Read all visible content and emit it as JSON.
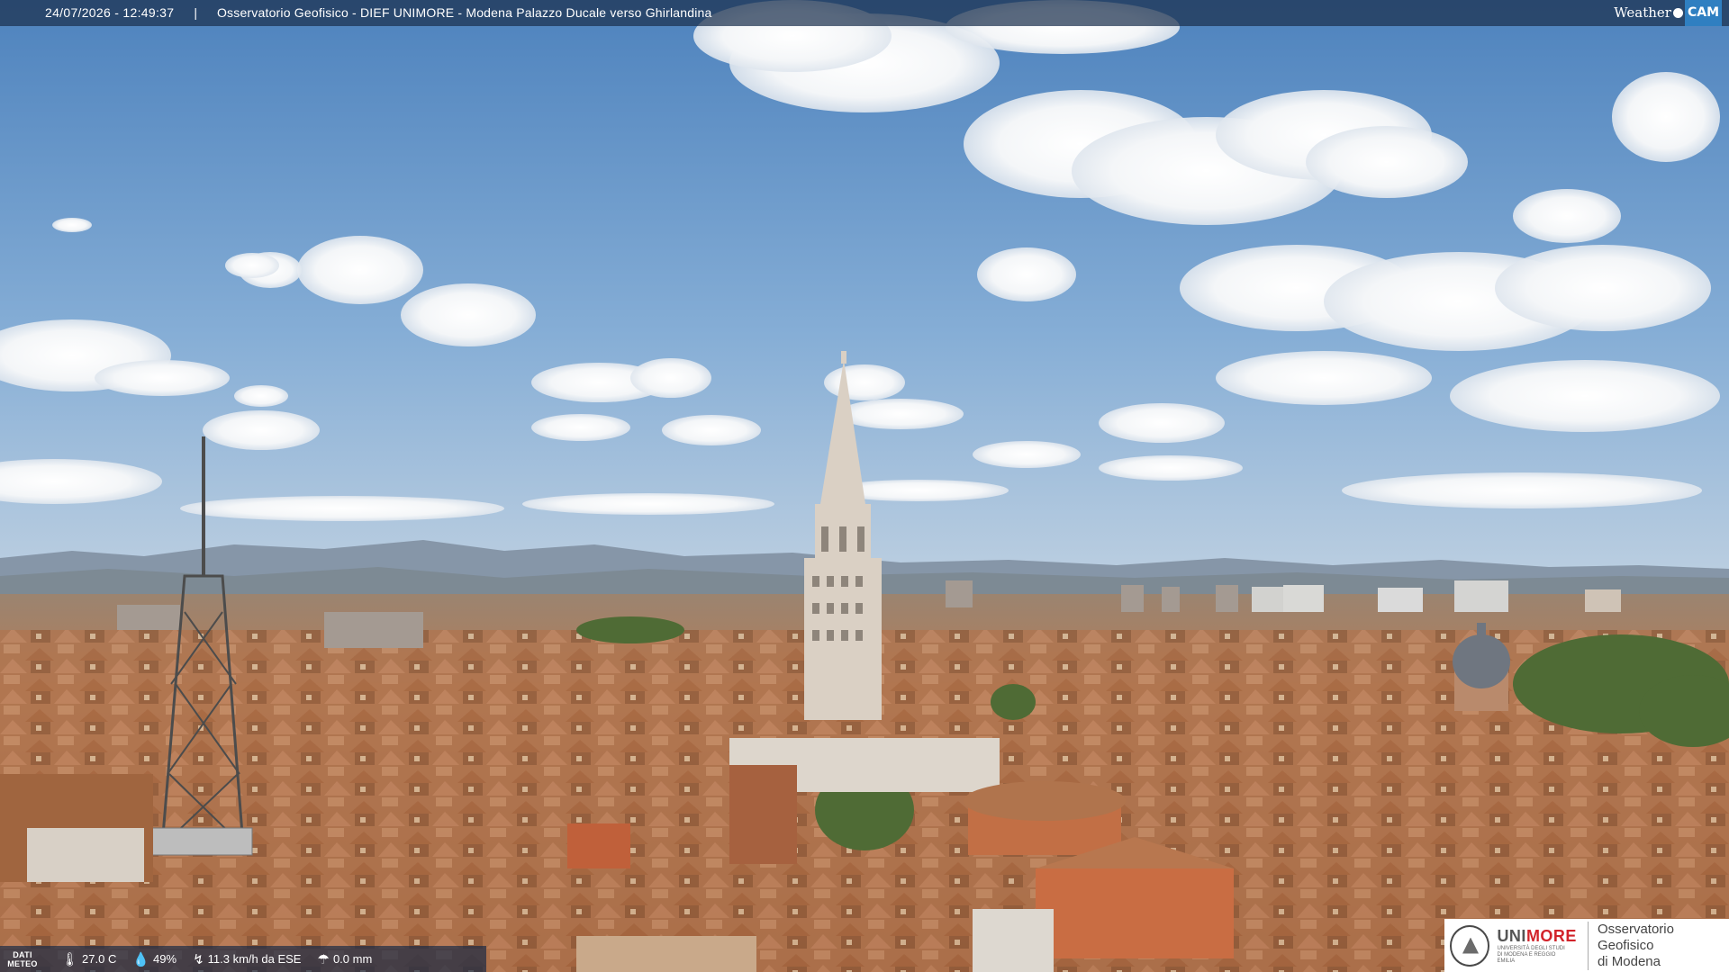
{
  "overlay": {
    "timestamp": "24/07/2026 - 12:49:37",
    "separator": "|",
    "title": "Osservatorio Geofisico - DIEF UNIMORE - Modena Palazzo Ducale verso Ghirlandina"
  },
  "brand": {
    "weather": "Weather",
    "cam": "CAM"
  },
  "weather_data": {
    "label": "DATI METEO",
    "temperature": "27.0 C",
    "humidity": "49%",
    "wind": "11.3 km/h da ESE",
    "rain": "0.0 mm",
    "icons": [
      "thermometer-icon",
      "humidity-icon",
      "wind-icon",
      "rain-icon"
    ]
  },
  "logo": {
    "unimore_prefix": "UNI",
    "unimore_suffix": "MORE",
    "university": "UNIVERSITÀ DEGLI STUDI DI MODENA E REGGIO EMILIA",
    "observatory_line1": "Osservatorio Geofisico",
    "observatory_line2": "di Modena"
  },
  "colors": {
    "sky_top": "#4f84bf",
    "sky_bottom": "#b5cbe0",
    "roofs": "#b57a55",
    "tower": "#d9cfc4",
    "unimore_red": "#d2232a"
  }
}
